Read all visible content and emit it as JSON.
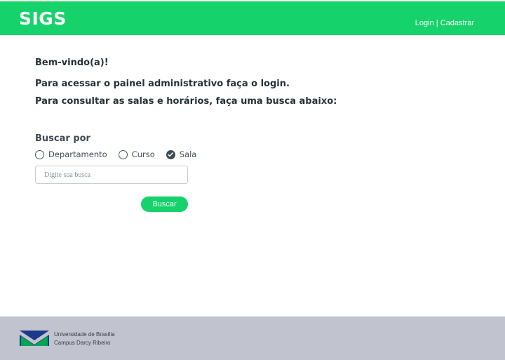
{
  "header": {
    "logo": "SIGS",
    "login_label": "Login",
    "separator": " | ",
    "register_label": "Cadastrar"
  },
  "main": {
    "welcome": "Bem-vindo(a)!",
    "intro_line1": "Para acessar o painel administrativo faça o login.",
    "intro_line2": "Para consultar as salas e horários, faça uma busca abaixo:"
  },
  "search": {
    "title": "Buscar por",
    "options": [
      {
        "label": "Departamento",
        "checked": false
      },
      {
        "label": "Curso",
        "checked": false
      },
      {
        "label": "Sala",
        "checked": true
      }
    ],
    "placeholder": "Digite sua busca",
    "value": "",
    "button_label": "Buscar"
  },
  "footer": {
    "line1": "Universidade de Brasília",
    "line2": "Campus Darcy Ribeiro"
  },
  "colors": {
    "brand_green": "#16d26a",
    "footer_bg": "#c1c3cf",
    "unb_blue": "#1b3a8a",
    "unb_green": "#00a651"
  },
  "icons": {
    "checked_radio": "check-icon",
    "logo": "unb-logo-icon"
  }
}
